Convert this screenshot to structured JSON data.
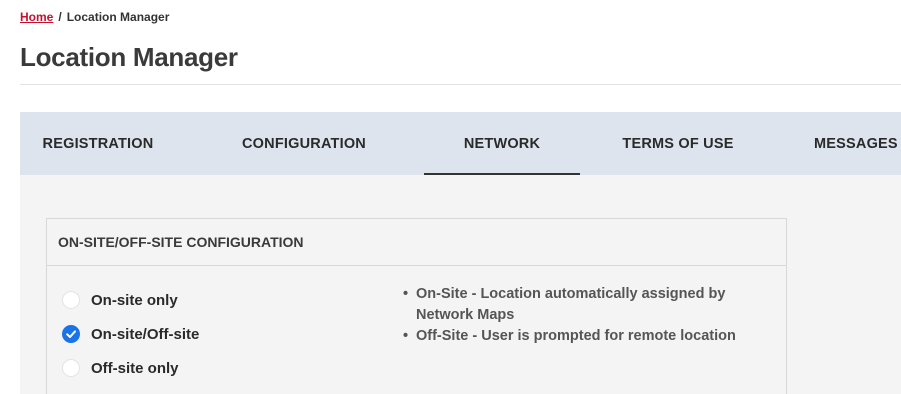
{
  "breadcrumb": {
    "home": "Home",
    "separator": "/",
    "current": "Location Manager"
  },
  "page_title": "Location Manager",
  "tabs": [
    {
      "label": "REGISTRATION",
      "active": false
    },
    {
      "label": "CONFIGURATION",
      "active": false
    },
    {
      "label": "NETWORK",
      "active": true
    },
    {
      "label": "TERMS OF USE",
      "active": false
    },
    {
      "label": "MESSAGES",
      "active": false
    }
  ],
  "config": {
    "title": "ON-SITE/OFF-SITE CONFIGURATION",
    "options": [
      {
        "label": "On-site only",
        "selected": false
      },
      {
        "label": "On-site/Off-site",
        "selected": true
      },
      {
        "label": "Off-site only",
        "selected": false
      }
    ],
    "help": [
      "On-Site - Location automatically assigned by Network Maps",
      "Off-Site - User is prompted for remote location"
    ]
  },
  "colors": {
    "link": "#c8102e",
    "tab_bar": "#dde4ed",
    "radio_checked": "#1a73e8"
  }
}
